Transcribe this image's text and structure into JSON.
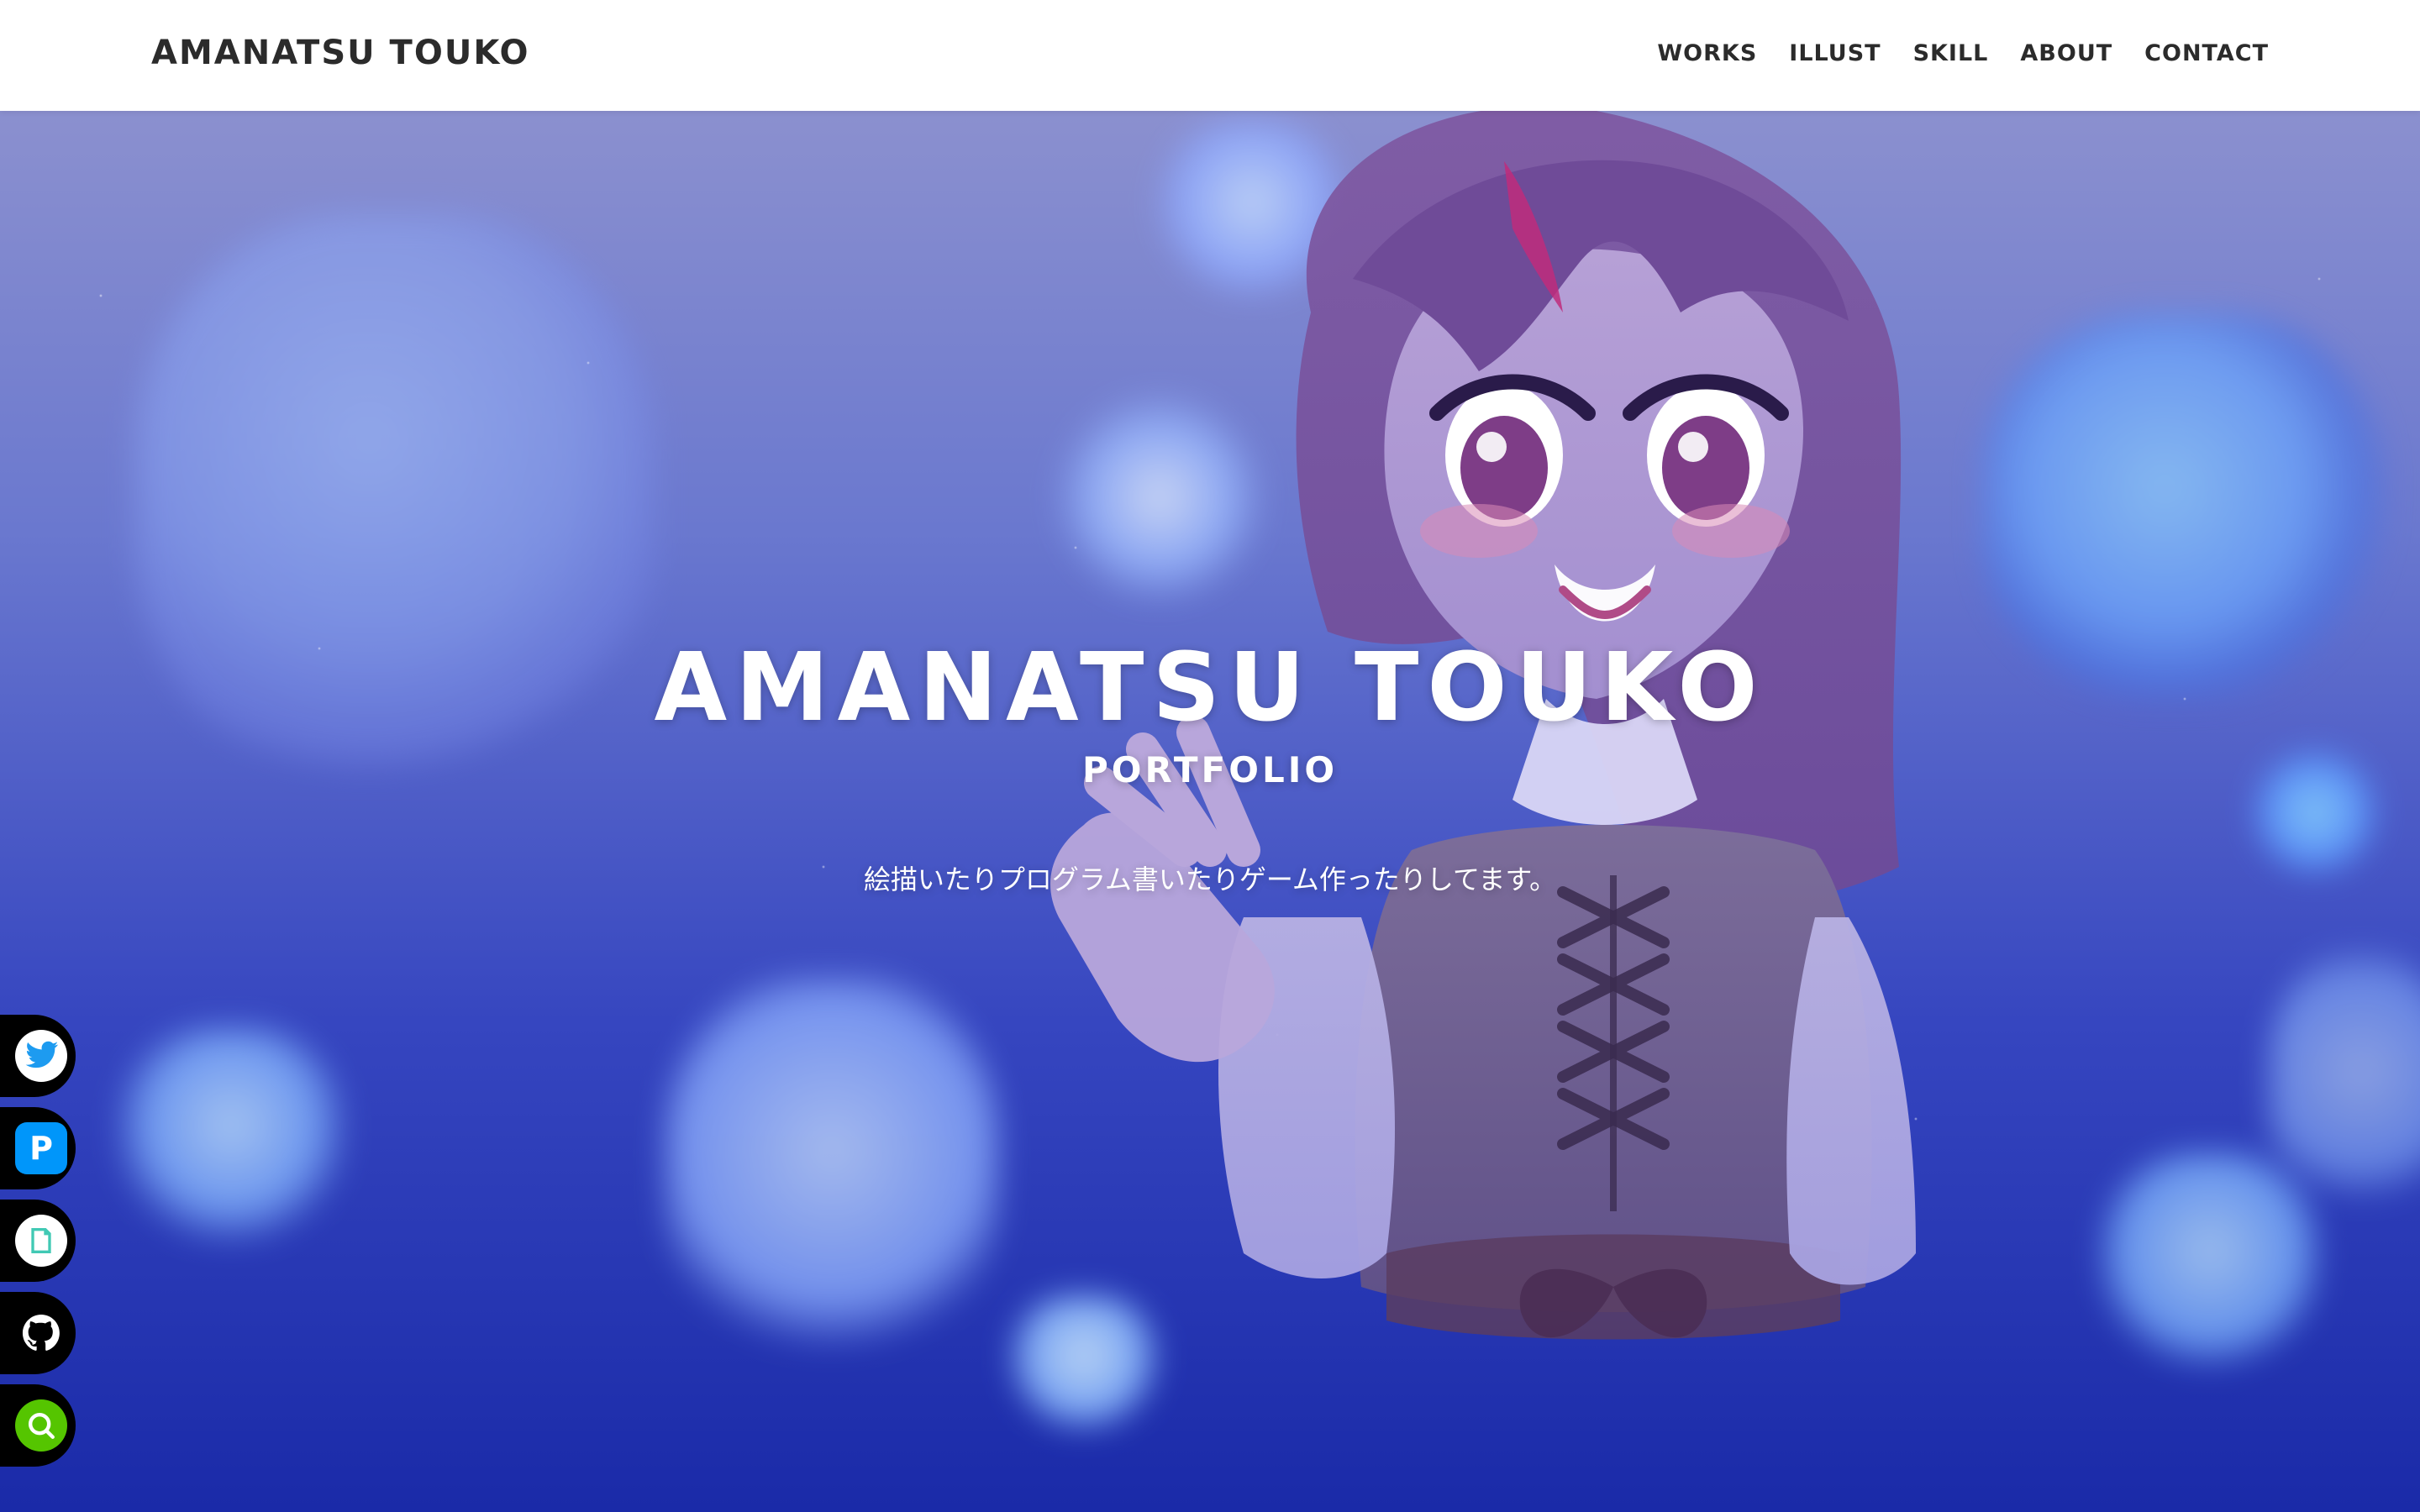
{
  "header": {
    "brand": "AMANATSU TOUKO",
    "nav": [
      {
        "label": "WORKS"
      },
      {
        "label": "ILLUST"
      },
      {
        "label": "SKILL"
      },
      {
        "label": "ABOUT"
      },
      {
        "label": "CONTACT"
      }
    ]
  },
  "hero": {
    "title": "AMANATSU TOUKO",
    "subtitle": "PORTFOLIO",
    "tagline": "絵描いたりプログラム書いたりゲーム作ったりしてます。"
  },
  "social": [
    {
      "icon": "twitter-icon",
      "color": "#1d9bf0"
    },
    {
      "icon": "pixiv-icon",
      "color": "#0096fa"
    },
    {
      "icon": "note-icon",
      "color": "#41c9b4"
    },
    {
      "icon": "github-icon",
      "color": "#000000"
    },
    {
      "icon": "qiita-icon",
      "color": "#55c500"
    }
  ],
  "colors": {
    "header_bg": "#ffffff",
    "header_text": "#2b2b2b",
    "hero_text": "#ffffff"
  }
}
